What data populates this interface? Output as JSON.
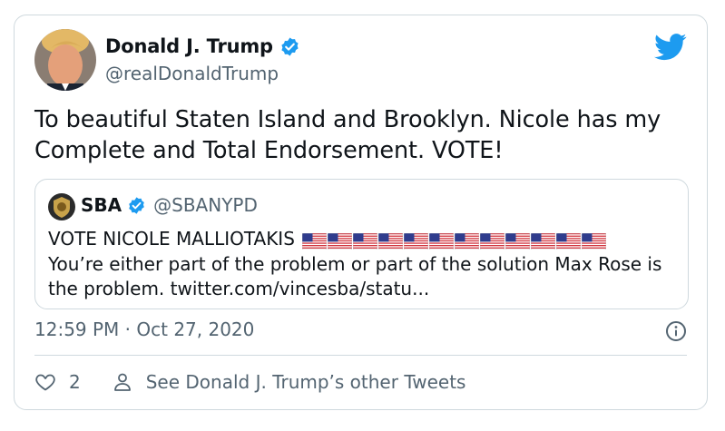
{
  "tweet": {
    "author_name": "Donald J. Trump",
    "author_handle": "@realDonaldTrump",
    "text": "To beautiful Staten Island and Brooklyn. Nicole has my Complete and Total Endorsement. VOTE!",
    "timestamp": "12:59 PM · Oct 27, 2020",
    "like_count": "2",
    "see_other_label": "See Donald J. Trump’s other Tweets"
  },
  "quoted_tweet": {
    "author_name": "SBA",
    "author_handle": "@SBANYPD",
    "line1": "VOTE NICOLE MALLIOTAKIS",
    "flag_count": 12,
    "text": "You’re either part of the problem or part of the solution Max Rose is the problem. twitter.com/vincesba/statu..."
  },
  "colors": {
    "brand_blue": "#1d9bf0",
    "text_primary": "#0f1419",
    "text_secondary": "#536471",
    "border": "#cfd9de"
  },
  "icons": [
    "verified-badge-icon",
    "twitter-bird-icon",
    "info-icon",
    "heart-icon",
    "person-icon",
    "us-flag-icon"
  ]
}
